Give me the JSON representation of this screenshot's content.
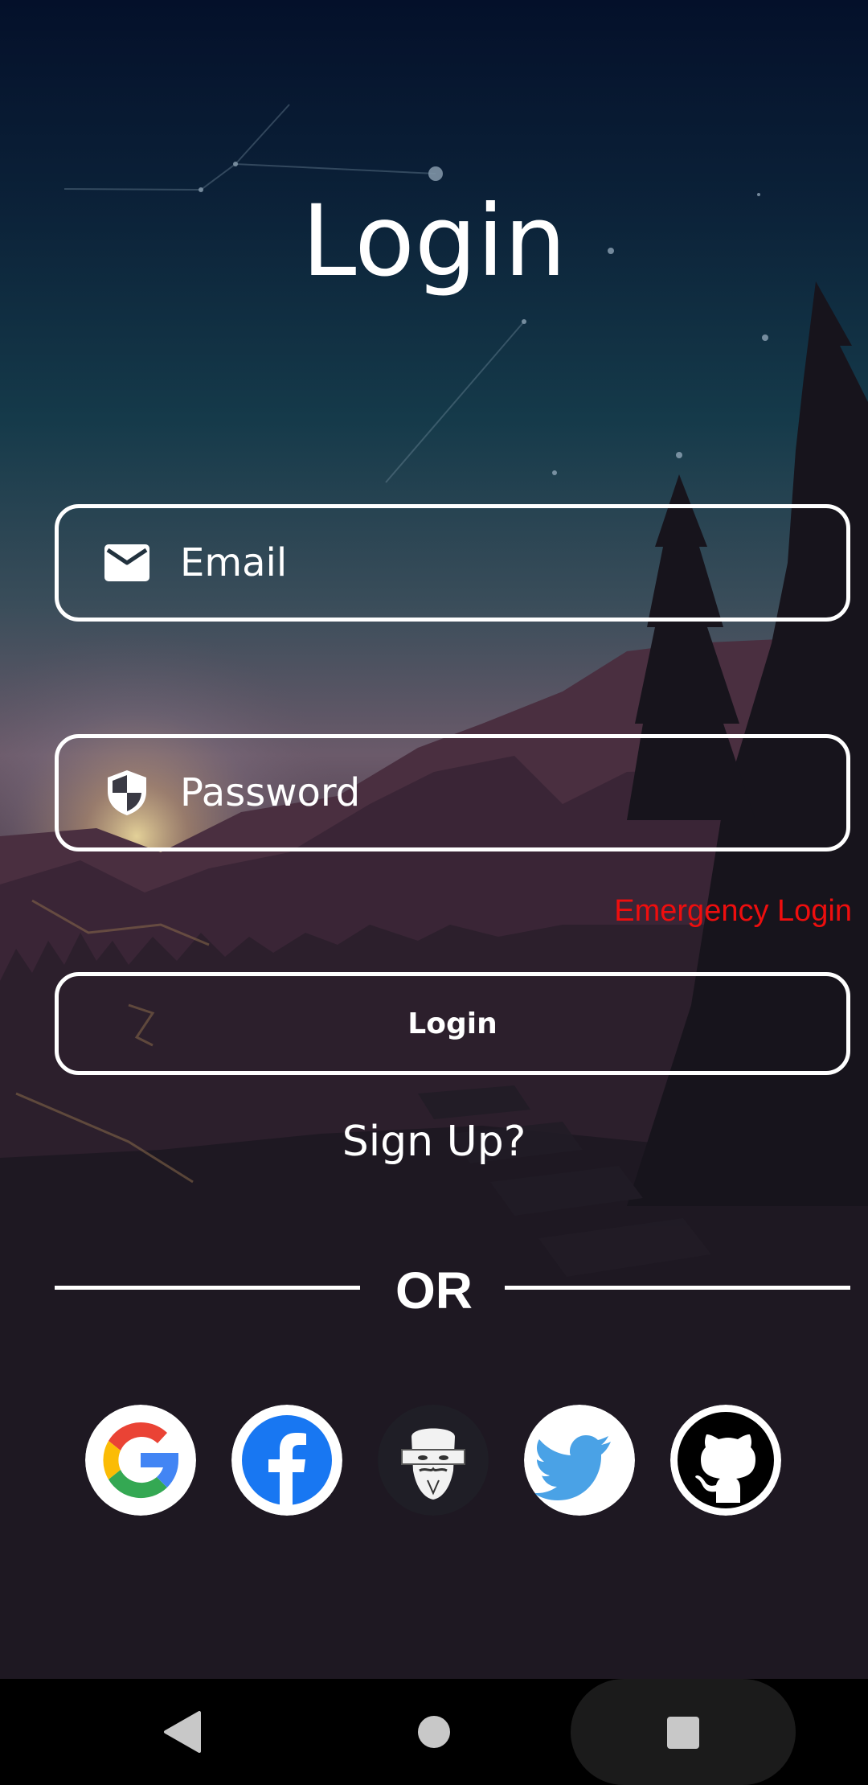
{
  "screen": {
    "title": "Login"
  },
  "form": {
    "email_placeholder": "Email",
    "password_placeholder": "Password",
    "emergency_login": "Emergency Login",
    "login_button": "Login",
    "signup_link": "Sign Up?",
    "divider_text": "OR"
  },
  "social_logins": [
    {
      "name": "google",
      "icon": "google-icon"
    },
    {
      "name": "facebook",
      "icon": "facebook-icon"
    },
    {
      "name": "anonymous",
      "icon": "anonymous-mask-icon"
    },
    {
      "name": "twitter",
      "icon": "twitter-bird-icon"
    },
    {
      "name": "github",
      "icon": "github-octocat-icon"
    }
  ],
  "navbar": {
    "back": "back-triangle-icon",
    "home": "home-circle-icon",
    "recents": "recents-square-icon"
  },
  "colors": {
    "emergency": "#ee0e0e",
    "accent_border": "#ffffff",
    "sky_top": "#04102a",
    "ground": "#15131a"
  }
}
